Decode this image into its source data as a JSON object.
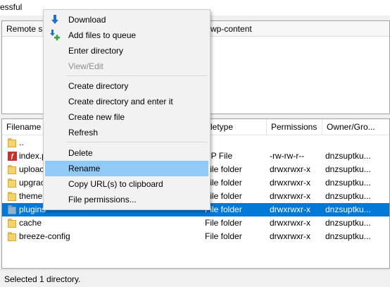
{
  "window": {
    "status_text": "essful"
  },
  "remote_site": {
    "label": "Remote si",
    "path": "wp-content"
  },
  "filelist": {
    "columns": {
      "filename": "Filename",
      "filetype": "letype",
      "permissions": "Permissions",
      "owner": "Owner/Gro..."
    },
    "rows": [
      {
        "name": "..",
        "type": "",
        "permissions": "",
        "owner": "",
        "icon": "folder-icon"
      },
      {
        "name": "index.p",
        "type": "HP File",
        "permissions": "-rw-rw-r--",
        "owner": "dnzsuptku...",
        "icon": "php-file-icon"
      },
      {
        "name": "uploac",
        "type": "File folder",
        "permissions": "drwxrwxr-x",
        "owner": "dnzsuptku...",
        "icon": "folder-icon"
      },
      {
        "name": "upgrac",
        "type": "File folder",
        "permissions": "drwxrwxr-x",
        "owner": "dnzsuptku...",
        "icon": "folder-icon"
      },
      {
        "name": "theme",
        "type": "File folder",
        "permissions": "drwxrwxr-x",
        "owner": "dnzsuptku...",
        "icon": "folder-icon"
      },
      {
        "name": "plugins",
        "type": "File folder",
        "permissions": "drwxrwxr-x",
        "owner": "dnzsuptku...",
        "icon": "folder-icon",
        "selected": true
      },
      {
        "name": "cache",
        "type": "File folder",
        "permissions": "drwxrwxr-x",
        "owner": "dnzsuptku...",
        "icon": "folder-icon"
      },
      {
        "name": "breeze-config",
        "type": "File folder",
        "permissions": "drwxrwxr-x",
        "owner": "dnzsuptku...",
        "icon": "folder-icon"
      }
    ]
  },
  "context_menu": {
    "items": [
      {
        "label": "Download",
        "icon": "download-arrow-icon"
      },
      {
        "label": "Add files to queue",
        "icon": "add-to-queue-icon"
      },
      {
        "label": "Enter directory"
      },
      {
        "label": "View/Edit",
        "disabled": true
      },
      {
        "label": "Create directory"
      },
      {
        "label": "Create directory and enter it"
      },
      {
        "label": "Create new file"
      },
      {
        "label": "Refresh"
      },
      {
        "label": "Delete"
      },
      {
        "label": "Rename",
        "highlighted": true
      },
      {
        "label": "Copy URL(s) to clipboard"
      },
      {
        "label": "File permissions..."
      }
    ]
  },
  "status_bar": {
    "text": "Selected 1 directory."
  },
  "colors": {
    "selection": "#0078d7",
    "menu_highlight": "#91c9f7",
    "folder": "#f6d26b",
    "download_arrow": "#1f6fd1",
    "add_plus": "#2faa3c"
  }
}
